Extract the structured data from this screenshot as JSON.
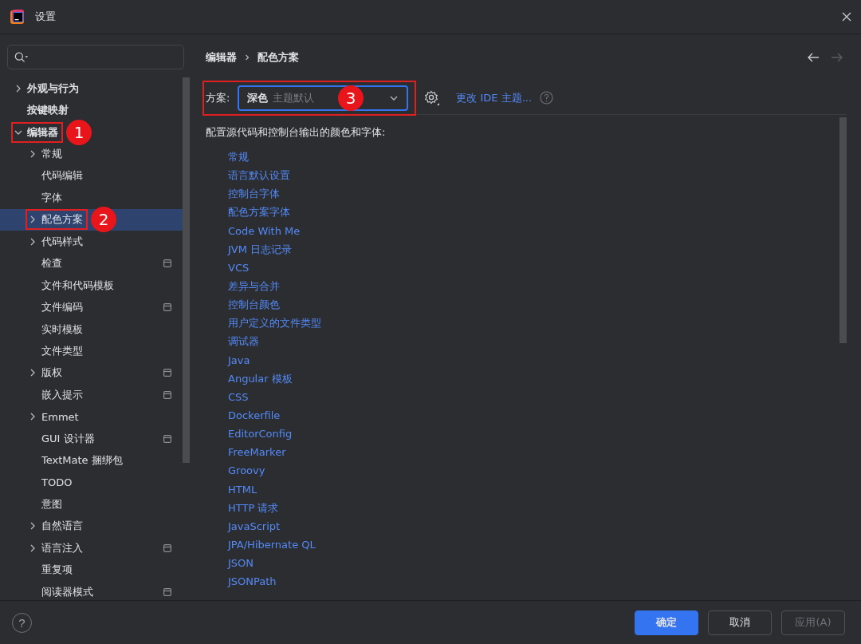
{
  "window": {
    "title": "设置"
  },
  "sidebar": {
    "items": [
      {
        "label": "外观与行为",
        "bold": true,
        "expandable": true,
        "expanded": false,
        "selected": false,
        "badge": false
      },
      {
        "label": "按键映射",
        "bold": true,
        "expandable": false,
        "selected": false,
        "badge": false
      },
      {
        "label": "编辑器",
        "bold": true,
        "expandable": true,
        "expanded": true,
        "selected": false,
        "badge": false,
        "callout": "1",
        "children": [
          {
            "label": "常规",
            "bold": false,
            "expandable": true,
            "expanded": false,
            "selected": false,
            "badge": false
          },
          {
            "label": "代码编辑",
            "bold": false,
            "expandable": false,
            "selected": false,
            "badge": false
          },
          {
            "label": "字体",
            "bold": false,
            "expandable": false,
            "selected": false,
            "badge": false
          },
          {
            "label": "配色方案",
            "bold": false,
            "expandable": true,
            "expanded": false,
            "selected": true,
            "badge": false,
            "callout": "2"
          },
          {
            "label": "代码样式",
            "bold": false,
            "expandable": true,
            "expanded": false,
            "selected": false,
            "badge": false
          },
          {
            "label": "检查",
            "bold": false,
            "expandable": false,
            "selected": false,
            "badge": true
          },
          {
            "label": "文件和代码模板",
            "bold": false,
            "expandable": false,
            "selected": false,
            "badge": false
          },
          {
            "label": "文件编码",
            "bold": false,
            "expandable": false,
            "selected": false,
            "badge": true
          },
          {
            "label": "实时模板",
            "bold": false,
            "expandable": false,
            "selected": false,
            "badge": false
          },
          {
            "label": "文件类型",
            "bold": false,
            "expandable": false,
            "selected": false,
            "badge": false
          },
          {
            "label": "版权",
            "bold": false,
            "expandable": true,
            "expanded": false,
            "selected": false,
            "badge": true
          },
          {
            "label": "嵌入提示",
            "bold": false,
            "expandable": false,
            "selected": false,
            "badge": true
          },
          {
            "label": "Emmet",
            "bold": false,
            "expandable": true,
            "expanded": false,
            "selected": false,
            "badge": false
          },
          {
            "label": "GUI 设计器",
            "bold": false,
            "expandable": false,
            "selected": false,
            "badge": true
          },
          {
            "label": "TextMate 捆绑包",
            "bold": false,
            "expandable": false,
            "selected": false,
            "badge": false
          },
          {
            "label": "TODO",
            "bold": false,
            "expandable": false,
            "selected": false,
            "badge": false
          },
          {
            "label": "意图",
            "bold": false,
            "expandable": false,
            "selected": false,
            "badge": false
          },
          {
            "label": "自然语言",
            "bold": false,
            "expandable": true,
            "expanded": false,
            "selected": false,
            "badge": false
          },
          {
            "label": "语言注入",
            "bold": false,
            "expandable": true,
            "expanded": false,
            "selected": false,
            "badge": true
          },
          {
            "label": "重复项",
            "bold": false,
            "expandable": false,
            "selected": false,
            "badge": false
          },
          {
            "label": "阅读器模式",
            "bold": false,
            "expandable": false,
            "selected": false,
            "badge": true
          }
        ]
      }
    ]
  },
  "breadcrumb": [
    "编辑器",
    "配色方案"
  ],
  "scheme": {
    "label": "方案:",
    "value": "深色",
    "hint": "主题默认",
    "callout": "3"
  },
  "change_theme_link": "更改 IDE 主题...",
  "description": "配置源代码和控制台输出的颜色和字体:",
  "links": [
    "常规",
    "语言默认设置",
    "控制台字体",
    "配色方案字体",
    "Code With Me",
    "JVM 日志记录",
    "VCS",
    "差异与合并",
    "控制台颜色",
    "用户定义的文件类型",
    "调试器",
    "Java",
    "Angular 模板",
    "CSS",
    "Dockerfile",
    "EditorConfig",
    "FreeMarker",
    "Groovy",
    "HTML",
    "HTTP 请求",
    "JavaScript",
    "JPA/Hibernate QL",
    "JSON",
    "JSONPath"
  ],
  "help": "?",
  "buttons": [
    {
      "label": "确定",
      "kind": "primary",
      "disabled": false
    },
    {
      "label": "取消",
      "kind": "normal",
      "disabled": false
    },
    {
      "label": "应用(A)",
      "kind": "normal",
      "disabled": true
    }
  ]
}
